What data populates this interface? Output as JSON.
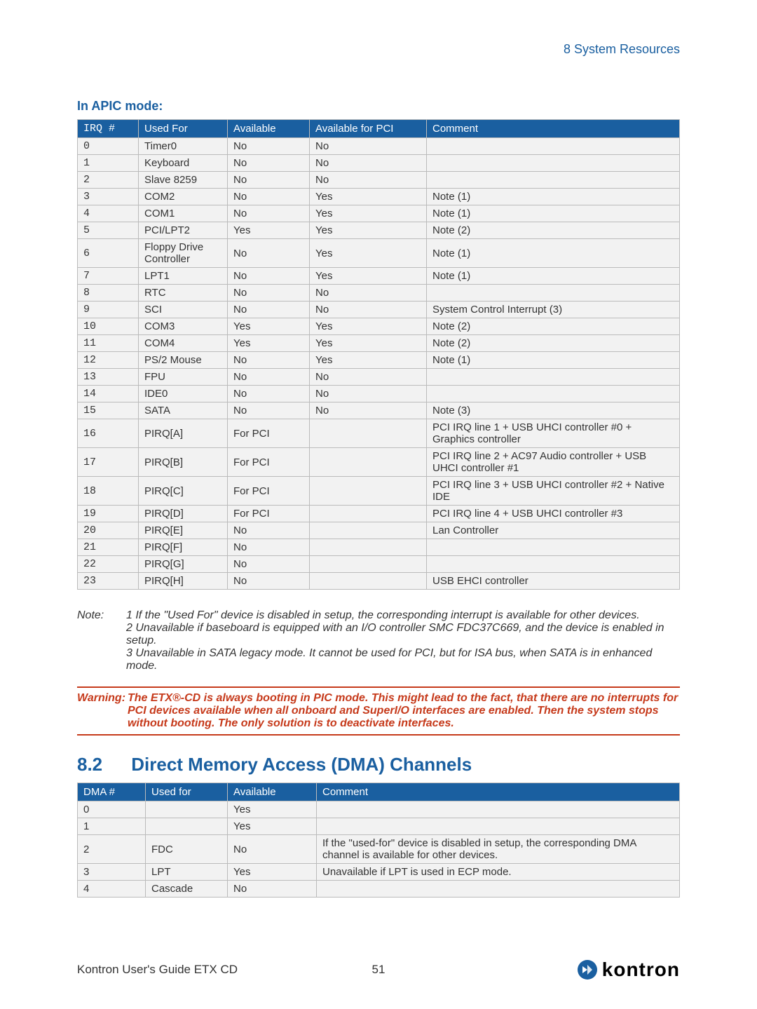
{
  "header": {
    "right": "8 System Resources"
  },
  "titles": {
    "apic": "In APIC mode:",
    "section_num": "8.2",
    "section_title": "Direct Memory Access (DMA) Channels"
  },
  "irq_headers": [
    "IRQ #",
    "Used For",
    "Available",
    "Available for PCI",
    "Comment"
  ],
  "irq_rows": [
    {
      "irq": "0",
      "used": "Timer0",
      "avail": "No",
      "pci": "No",
      "comment": ""
    },
    {
      "irq": "1",
      "used": "Keyboard",
      "avail": "No",
      "pci": "No",
      "comment": ""
    },
    {
      "irq": "2",
      "used": "Slave 8259",
      "avail": "No",
      "pci": "No",
      "comment": ""
    },
    {
      "irq": "3",
      "used": "COM2",
      "avail": "No",
      "pci": "Yes",
      "comment": "Note (1)"
    },
    {
      "irq": "4",
      "used": "COM1",
      "avail": "No",
      "pci": "Yes",
      "comment": "Note (1)"
    },
    {
      "irq": "5",
      "used": "PCI/LPT2",
      "avail": "Yes",
      "pci": "Yes",
      "comment": "Note (2)"
    },
    {
      "irq": "6",
      "used": "Floppy Drive Controller",
      "avail": "No",
      "pci": "Yes",
      "comment": "Note (1)"
    },
    {
      "irq": "7",
      "used": "LPT1",
      "avail": "No",
      "pci": "Yes",
      "comment": "Note (1)"
    },
    {
      "irq": "8",
      "used": "RTC",
      "avail": "No",
      "pci": "No",
      "comment": ""
    },
    {
      "irq": "9",
      "used": "SCI",
      "avail": "No",
      "pci": "No",
      "comment": "System Control Interrupt (3)"
    },
    {
      "irq": "10",
      "used": "COM3",
      "avail": "Yes",
      "pci": "Yes",
      "comment": "Note (2)"
    },
    {
      "irq": "11",
      "used": "COM4",
      "avail": "Yes",
      "pci": "Yes",
      "comment": "Note (2)"
    },
    {
      "irq": "12",
      "used": "PS/2 Mouse",
      "avail": "No",
      "pci": "Yes",
      "comment": "Note (1)"
    },
    {
      "irq": "13",
      "used": "FPU",
      "avail": "No",
      "pci": "No",
      "comment": ""
    },
    {
      "irq": "14",
      "used": "IDE0",
      "avail": "No",
      "pci": "No",
      "comment": ""
    },
    {
      "irq": "15",
      "used": "SATA",
      "avail": "No",
      "pci": "No",
      "comment": "Note (3)"
    },
    {
      "irq": "16",
      "used": "PIRQ[A]",
      "avail": "For PCI",
      "pci": "",
      "comment": "PCI IRQ line 1 + USB UHCI controller #0 + Graphics controller"
    },
    {
      "irq": "17",
      "used": "PIRQ[B]",
      "avail": "For PCI",
      "pci": "",
      "comment": "PCI IRQ line 2 + AC97 Audio controller + USB UHCI controller #1"
    },
    {
      "irq": "18",
      "used": "PIRQ[C]",
      "avail": "For PCI",
      "pci": "",
      "comment": "PCI IRQ line 3 + USB UHCI controller #2 + Native IDE"
    },
    {
      "irq": "19",
      "used": "PIRQ[D]",
      "avail": "For PCI",
      "pci": "",
      "comment": "PCI IRQ line 4 + USB UHCI controller #3"
    },
    {
      "irq": "20",
      "used": "PIRQ[E]",
      "avail": "No",
      "pci": "",
      "comment": "Lan Controller"
    },
    {
      "irq": "21",
      "used": "PIRQ[F]",
      "avail": "No",
      "pci": "",
      "comment": ""
    },
    {
      "irq": "22",
      "used": "PIRQ[G]",
      "avail": "No",
      "pci": "",
      "comment": ""
    },
    {
      "irq": "23",
      "used": "PIRQ[H]",
      "avail": "No",
      "pci": "",
      "comment": "USB EHCI controller"
    }
  ],
  "note": {
    "label": "Note:",
    "lines": [
      "1 If the \"Used For\" device is disabled in setup, the corresponding interrupt is available for other devices.",
      "2 Unavailable if baseboard is equipped with an I/O controller SMC FDC37C669, and the device is enabled in setup.",
      "3 Unavailable in SATA legacy mode. It cannot be used for PCI, but for ISA bus, when SATA is in enhanced mode."
    ]
  },
  "warning": {
    "label": "Warning:",
    "text": "The ETX®-CD is always booting in PIC mode. This might lead to the fact, that there are no interrupts for PCI devices available when all onboard and SuperI/O interfaces are enabled. Then the system stops without booting. The only solution is to deactivate interfaces."
  },
  "dma_headers": [
    "DMA #",
    "Used for",
    "Available",
    "Comment"
  ],
  "dma_rows": [
    {
      "dma": "0",
      "used": "",
      "avail": "Yes",
      "comment": ""
    },
    {
      "dma": "1",
      "used": "",
      "avail": "Yes",
      "comment": ""
    },
    {
      "dma": "2",
      "used": "FDC",
      "avail": "No",
      "comment": "If the \"used-for\" device is disabled in setup, the corresponding DMA channel is available for other devices."
    },
    {
      "dma": "3",
      "used": "LPT",
      "avail": "Yes",
      "comment": "Unavailable if LPT is used in ECP mode."
    },
    {
      "dma": "4",
      "used": "Cascade",
      "avail": "No",
      "comment": ""
    }
  ],
  "footer": {
    "left": "Kontron User's Guide ETX CD",
    "page": "51",
    "brand": "kontron"
  }
}
